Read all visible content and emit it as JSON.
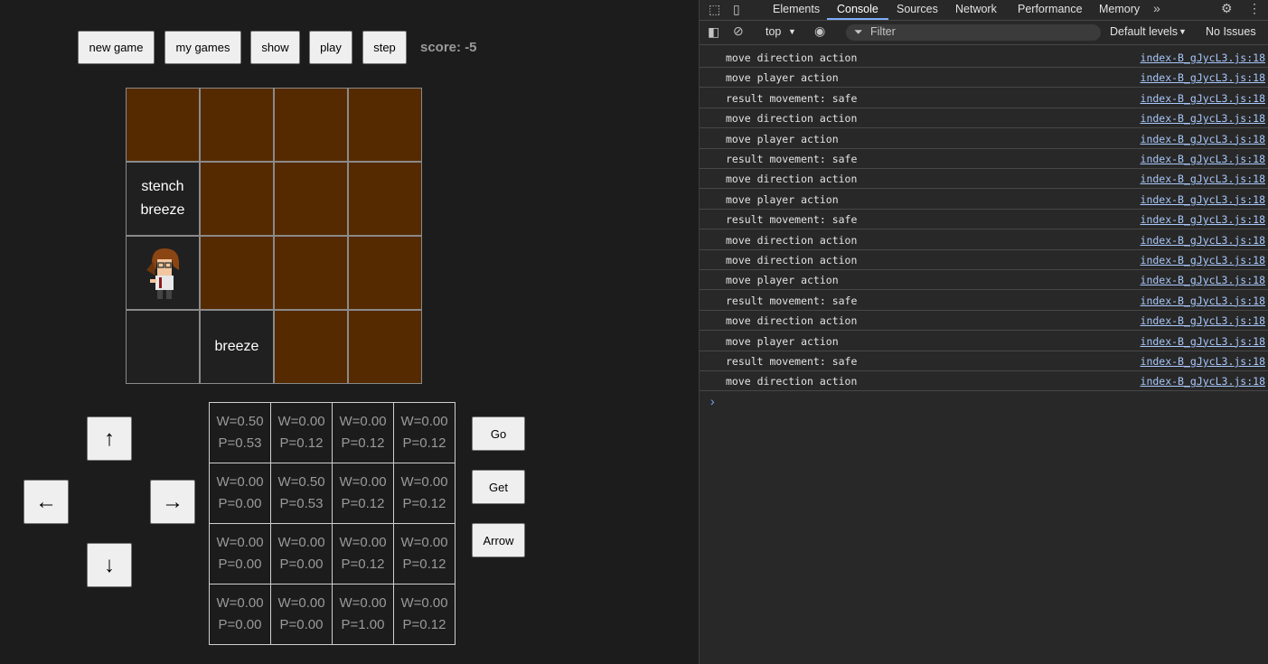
{
  "controls": {
    "new_game": "new game",
    "my_games": "my games",
    "show": "show",
    "play": "play",
    "step": "step",
    "score": "score: -5"
  },
  "board": [
    [
      {
        "text1": "",
        "text2": "",
        "visited": false
      },
      {
        "text1": "",
        "text2": "",
        "visited": false
      },
      {
        "text1": "",
        "text2": "",
        "visited": false
      },
      {
        "text1": "",
        "text2": "",
        "visited": false
      }
    ],
    [
      {
        "text1": "stench",
        "text2": "breeze",
        "visited": true
      },
      {
        "text1": "",
        "text2": "",
        "visited": false
      },
      {
        "text1": "",
        "text2": "",
        "visited": false
      },
      {
        "text1": "",
        "text2": "",
        "visited": false
      }
    ],
    [
      {
        "text1": "",
        "text2": "",
        "visited": true,
        "player": true
      },
      {
        "text1": "",
        "text2": "",
        "visited": false
      },
      {
        "text1": "",
        "text2": "",
        "visited": false
      },
      {
        "text1": "",
        "text2": "",
        "visited": false
      }
    ],
    [
      {
        "text1": "",
        "text2": "",
        "visited": true
      },
      {
        "text1": "breeze",
        "text2": "",
        "visited": true
      },
      {
        "text1": "",
        "text2": "",
        "visited": false
      },
      {
        "text1": "",
        "text2": "",
        "visited": false
      }
    ]
  ],
  "dpad": {
    "up": "↑",
    "left": "←",
    "right": "→",
    "down": "↓"
  },
  "probabilities": [
    [
      [
        "W=0.50",
        "P=0.53"
      ],
      [
        "W=0.00",
        "P=0.12"
      ],
      [
        "W=0.00",
        "P=0.12"
      ],
      [
        "W=0.00",
        "P=0.12"
      ]
    ],
    [
      [
        "W=0.00",
        "P=0.00"
      ],
      [
        "W=0.50",
        "P=0.53"
      ],
      [
        "W=0.00",
        "P=0.12"
      ],
      [
        "W=0.00",
        "P=0.12"
      ]
    ],
    [
      [
        "W=0.00",
        "P=0.00"
      ],
      [
        "W=0.00",
        "P=0.00"
      ],
      [
        "W=0.00",
        "P=0.12"
      ],
      [
        "W=0.00",
        "P=0.12"
      ]
    ],
    [
      [
        "W=0.00",
        "P=0.00"
      ],
      [
        "W=0.00",
        "P=0.00"
      ],
      [
        "W=0.00",
        "P=1.00"
      ],
      [
        "W=0.00",
        "P=0.12"
      ]
    ]
  ],
  "actions": {
    "go": "Go",
    "get": "Get",
    "arrow": "Arrow"
  },
  "devtools": {
    "tabs": [
      "Elements",
      "Console",
      "Sources",
      "Network",
      "Performance",
      "Memory"
    ],
    "active_tab": "Console",
    "context": "top",
    "filter_placeholder": "Filter",
    "levels": "Default levels",
    "issues": "No Issues",
    "source": "index-B_gJycL3.js:18",
    "logs": [
      "move direction action",
      "move player action",
      "result movement: safe",
      "move direction action",
      "move player action",
      "result movement: safe",
      "move direction action",
      "move player action",
      "result movement: safe",
      "move direction action",
      "move direction action",
      "move player action",
      "result movement: safe",
      "move direction action",
      "move player action",
      "result movement: safe",
      "move direction action"
    ]
  }
}
